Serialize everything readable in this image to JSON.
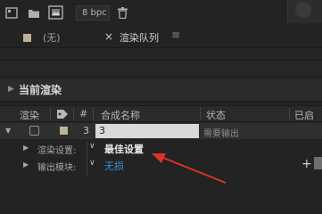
{
  "toolbar": {
    "bpc_label": "8 bpc",
    "icons": [
      "render-queue-icon",
      "folder-icon",
      "footage-icon",
      "trash-icon"
    ]
  },
  "tabs": {
    "none_label": "(无)",
    "active_close": "×",
    "active_label": "渲染队列",
    "active_menu": "≡"
  },
  "section": {
    "title": "当前渲染"
  },
  "table": {
    "columns": {
      "render": "渲染",
      "number": "#",
      "comp_name": "合成名称",
      "status": "状态",
      "started": "已启动"
    }
  },
  "row": {
    "number": "3",
    "comp_name": "3",
    "status": "需要输出"
  },
  "settings": {
    "render_label": "渲染设置:",
    "render_value": "最佳设置",
    "output_label": "输出模块:",
    "output_value": "无损"
  },
  "colors": {
    "accent_link": "#3f8fd6",
    "annotation_arrow": "#e0302a",
    "label_swatch": "#bfb09a"
  }
}
